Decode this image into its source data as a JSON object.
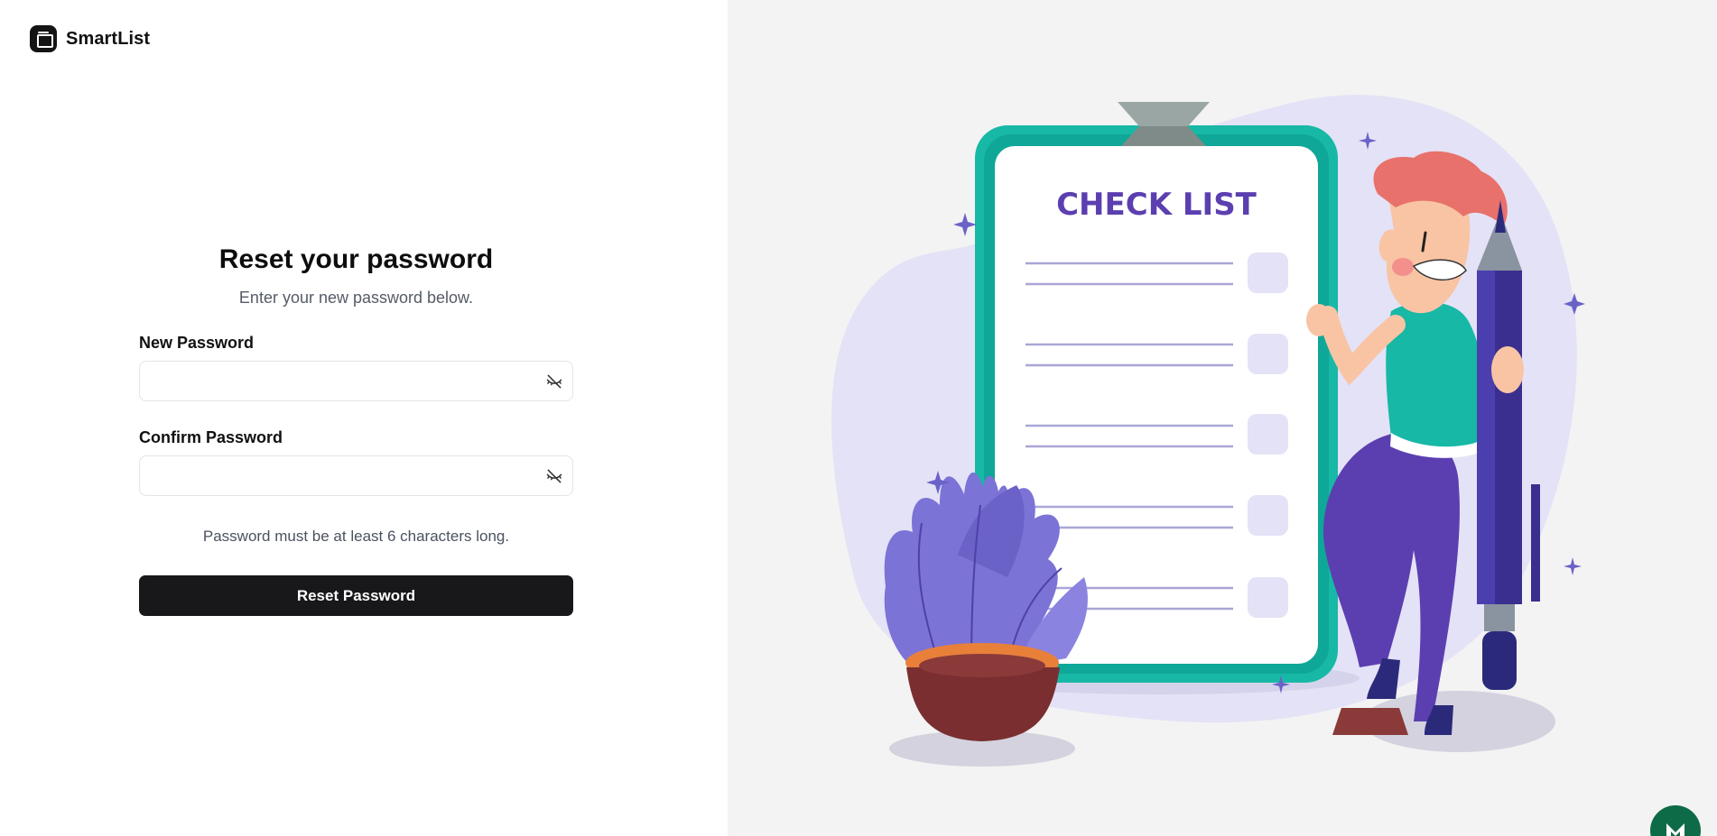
{
  "app": {
    "name": "SmartList"
  },
  "form": {
    "title": "Reset your password",
    "subtitle": "Enter your new password below.",
    "new_password": {
      "label": "New Password",
      "value": "",
      "placeholder": ""
    },
    "confirm_password": {
      "label": "Confirm Password",
      "value": "",
      "placeholder": ""
    },
    "hint": "Password must be at least 6 characters long.",
    "submit_label": "Reset Password"
  },
  "illustration": {
    "clipboard_title": "CHECK LIST",
    "checklist_rows": 5
  },
  "icons": {
    "brand": "app-logo-icon",
    "toggle_visibility": "eye-off-icon",
    "corner_badge": "m-logo-icon"
  },
  "colors": {
    "primary_button": "#18181b",
    "teal": "#17b8a6",
    "purple": "#5b3fb0",
    "lavender": "#e4e2f6",
    "right_panel_bg": "#f3f3f3",
    "badge": "#0e6b47"
  }
}
